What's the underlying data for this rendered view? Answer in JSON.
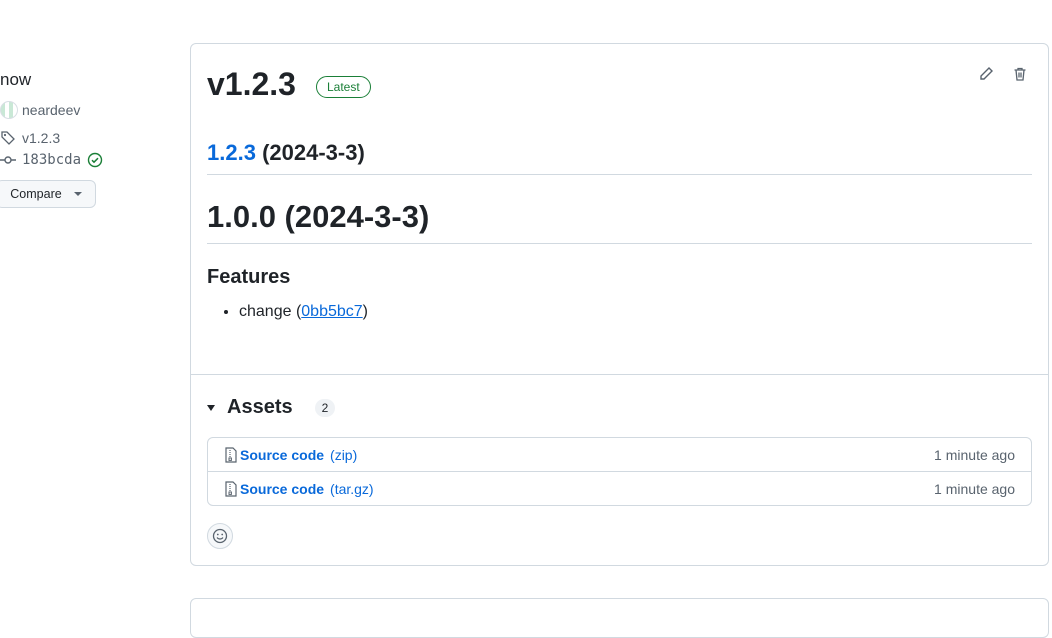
{
  "sidebar": {
    "time_label": "now",
    "author": "neardeev",
    "tag": "v1.2.3",
    "commit": "183bcda",
    "compare_label": "Compare"
  },
  "release": {
    "title": "v1.2.3",
    "latest_badge": "Latest",
    "notes": {
      "h2_link": "1.2.3",
      "h2_date": "(2024-3-3)",
      "h1": "1.0.0 (2024-3-3)",
      "h3": "Features",
      "items": [
        {
          "text_before": "change (",
          "link": "0bb5bc7",
          "text_after": ")"
        }
      ]
    },
    "assets": {
      "title": "Assets",
      "count": "2",
      "rows": [
        {
          "name": "Source code",
          "ext": "(zip)",
          "time": "1 minute ago"
        },
        {
          "name": "Source code",
          "ext": "(tar.gz)",
          "time": "1 minute ago"
        }
      ]
    }
  },
  "icons": [
    "tag-icon",
    "commit-icon",
    "verified-icon",
    "pencil-icon",
    "trash-icon",
    "file-zip-icon",
    "smiley-icon"
  ],
  "colors": {
    "link": "#0969da",
    "success": "#1a7f37",
    "border": "#d1d9e0"
  }
}
